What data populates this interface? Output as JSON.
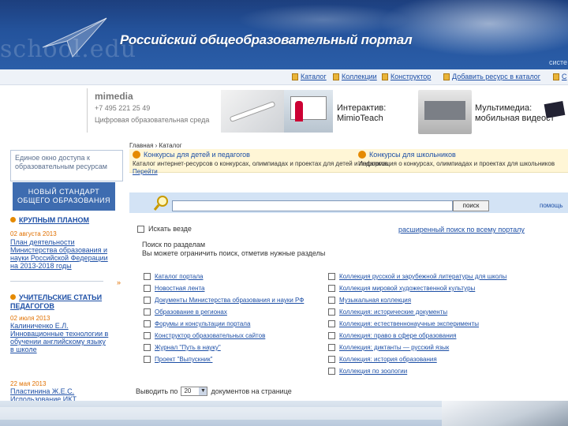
{
  "header": {
    "title": "Российский общеобразовательный портал",
    "watermark": "school.edu",
    "right_text": "систе"
  },
  "topnav": {
    "items": [
      {
        "label": "Каталог"
      },
      {
        "label": "Коллекции"
      },
      {
        "label": "Конструктор"
      },
      {
        "label": "Добавить ресурс в каталог"
      },
      {
        "label": "С"
      }
    ]
  },
  "banner": {
    "logo": "mimedia",
    "phone": "+7 495 221 25 49",
    "slogan": "Цифровая образовательная среда",
    "promo1": {
      "line1": "Интерактив:",
      "line2": "MimioTeach"
    },
    "promo2": {
      "line1": "Мультимедиа:",
      "line2": "мобильная видеост"
    }
  },
  "sidebar": {
    "box_text": "Единое окно доступа к образовательным ресурсам",
    "button_label": "НОВЫЙ СТАНДАРТ ОБЩЕГО ОБРАЗОВАНИЯ",
    "section1": {
      "heading": "КРУПНЫМ ПЛАНОМ",
      "date": "02 августа 2013",
      "link": "План деятельности Министерства образования и науки Российской Федерации на 2013-2018 годы"
    },
    "section2": {
      "heading": "УЧИТЕЛЬСКИЕ СТАТЬИ ПЕДАГОГОВ",
      "date1": "02 июля 2013",
      "author1": "Калиниченко Е.Л.",
      "link1": "Инновационные технологии в обучении английскому языку в школе",
      "date2": "22 мая 2013",
      "author2": "Пластинина Ж.Е.С.",
      "link2": "Использование ИКТ"
    }
  },
  "main": {
    "breadcrumb": "Главная › Каталог",
    "contest_left": {
      "title": "Конкурсы для детей и педагогов",
      "desc": "Каталог интернет-ресурсов о конкурсах, олимпиадах и проектах для детей и педагогов",
      "more": "Перейти"
    },
    "contest_right": {
      "title": "Конкурсы для школьников",
      "desc": "Информация о конкурсах, олимпиадах и проектах для школьников"
    },
    "search": {
      "placeholder": "",
      "button": "поиск",
      "right_label": "помощь"
    },
    "search_all_label": "Искать везде",
    "advanced_link": "расширенный поиск по всему порталу",
    "section_title_line1": "Поиск по разделам",
    "section_title_line2": "Вы можете ограничить поиск, отметив нужные разделы",
    "categories_left": [
      "Каталог портала",
      "Новостная лента",
      "Документы Министерства образования и науки РФ",
      "Образование в регионах",
      "Форумы и консультации портала",
      "Конструктор образовательных сайтов",
      "Журнал \"Путь в науку\"",
      "Проект \"Выпускник\""
    ],
    "categories_right": [
      "Коллекция русской и зарубежной литературы для школы",
      "Коллекция мировой художественной культуры",
      "Музыкальная коллекция",
      "Коллекция: исторические документы",
      "Коллекция: естественнонаучные эксперименты",
      "Коллекция: право в сфере образования",
      "Коллекция: диктанты — русский язык",
      "Коллекция: история образования",
      "Коллекция по зоологии"
    ],
    "per_page": {
      "prefix": "Выводить по",
      "value": "20",
      "suffix": "документов на странице"
    }
  }
}
